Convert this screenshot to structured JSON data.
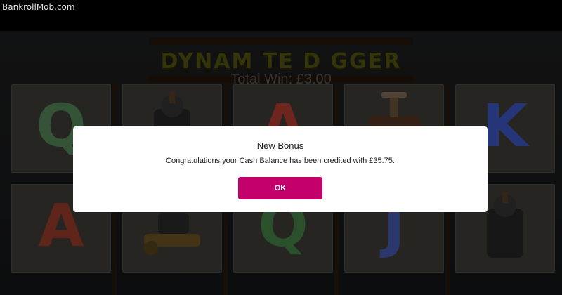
{
  "brand": {
    "label": "BankrollMob.com"
  },
  "game": {
    "title": "DYNAM TE D GGER",
    "total_win": "Total Win: £3.00",
    "reels": [
      {
        "top": "Q",
        "bottom": "A"
      },
      {
        "top": "dynamite-bundle",
        "bottom": "dynamite-stick"
      },
      {
        "top": "A",
        "bottom": "Q"
      },
      {
        "top": "tnt-plunger",
        "bottom": "J"
      },
      {
        "top": "K",
        "bottom": "dynamite-bundle"
      }
    ]
  },
  "modal": {
    "title": "New Bonus",
    "message": "Congratulations your Cash Balance has been credited with £35.75.",
    "ok_label": "OK"
  },
  "colors": {
    "accent": "#c4006b",
    "modal_bg": "#ffffff",
    "overlay": "#000000"
  }
}
